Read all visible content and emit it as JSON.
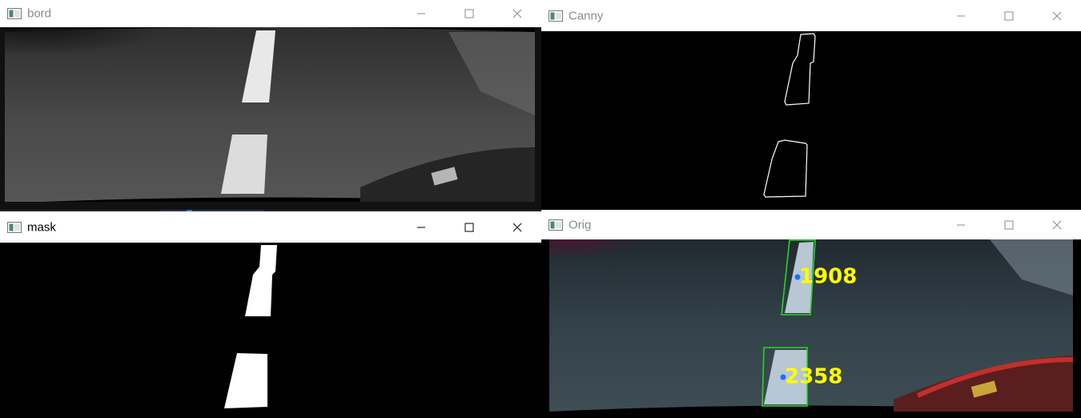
{
  "windows": {
    "bord": {
      "title": "bord",
      "active": false
    },
    "canny": {
      "title": "Canny",
      "active": false
    },
    "mask": {
      "title": "mask",
      "active": true
    },
    "orig": {
      "title": "Orig",
      "active": false
    }
  },
  "window_controls": [
    "minimize-icon",
    "maximize-icon",
    "close-icon"
  ],
  "detections": [
    {
      "label": "1908"
    },
    {
      "label": "2358"
    }
  ],
  "colors": {
    "contour": "#26d626",
    "label_text": "#ffff00",
    "centroid": "#1e6cff",
    "edge_lines": "#ffffff",
    "taskbar_bg": "#2b3848"
  }
}
